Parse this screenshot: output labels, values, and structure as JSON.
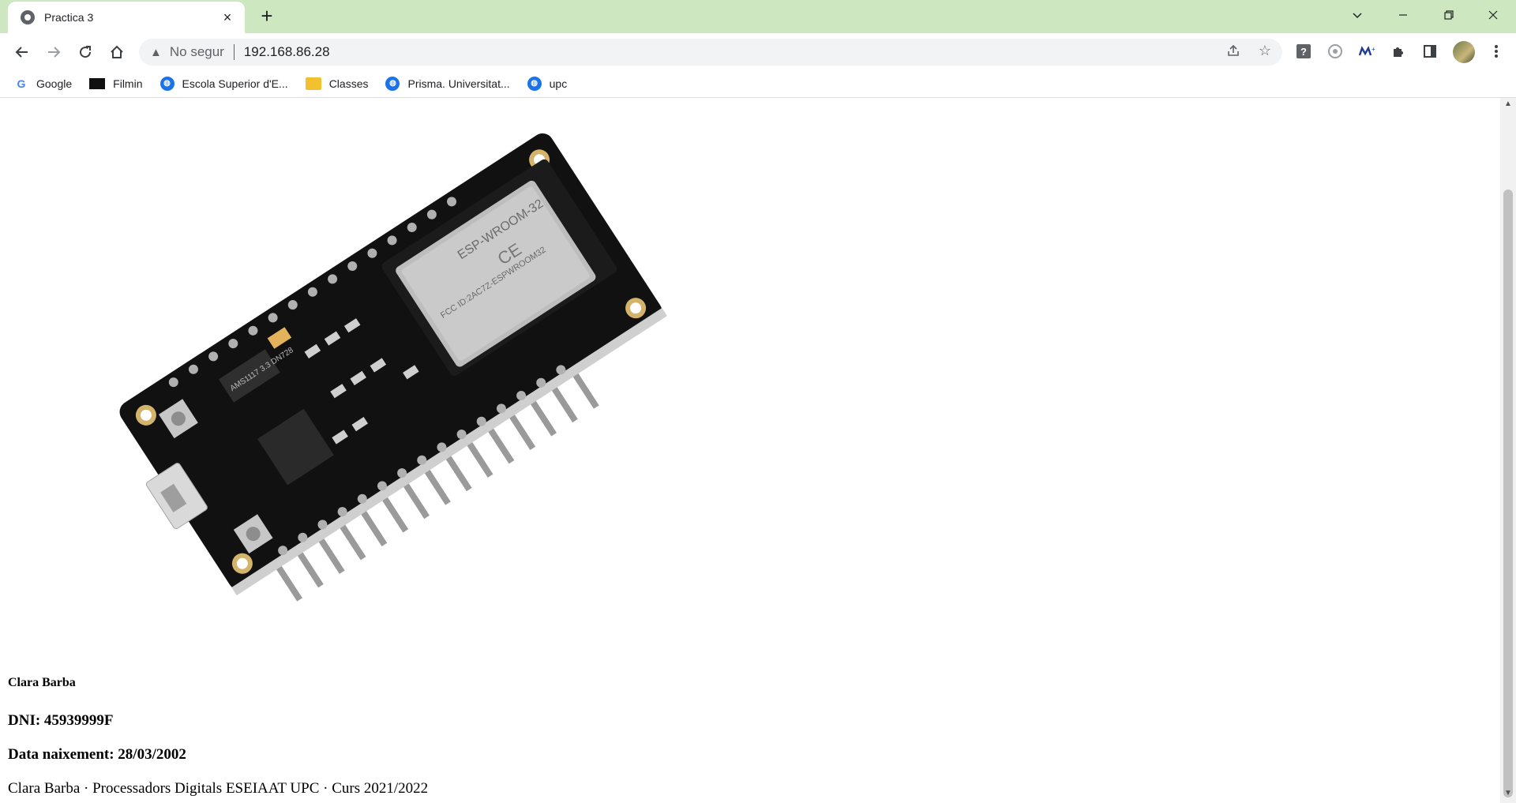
{
  "browser": {
    "tab_title": "Practica 3",
    "tab_close": "×",
    "new_tab": "+",
    "address": {
      "security_label": "No segur",
      "url": "192.168.86.28"
    },
    "bookmarks": [
      {
        "label": "Google",
        "icon": "google-icon"
      },
      {
        "label": "Filmin",
        "icon": "filmin-icon"
      },
      {
        "label": "Escola Superior d'E...",
        "icon": "globe-icon"
      },
      {
        "label": "Classes",
        "icon": "classroom-icon"
      },
      {
        "label": "Prisma. Universitat...",
        "icon": "globe-icon"
      },
      {
        "label": "upc",
        "icon": "globe-icon"
      }
    ]
  },
  "page": {
    "image_alt": "ESP32 DevKit board (ESP-WROOM-32)",
    "board_labels": {
      "module": "ESP-WROOM-32",
      "regulator": "AMS1117 3.3 DN728",
      "fcc": "FCC ID:2AC7Z-ESPWROOM32"
    },
    "name": "Clara Barba",
    "dni": "DNI: 45939999F",
    "birth": "Data naixement: 28/03/2002",
    "footer": "Clara Barba · Processadors Digitals ESEIAAT UPC · Curs 2021/2022"
  }
}
